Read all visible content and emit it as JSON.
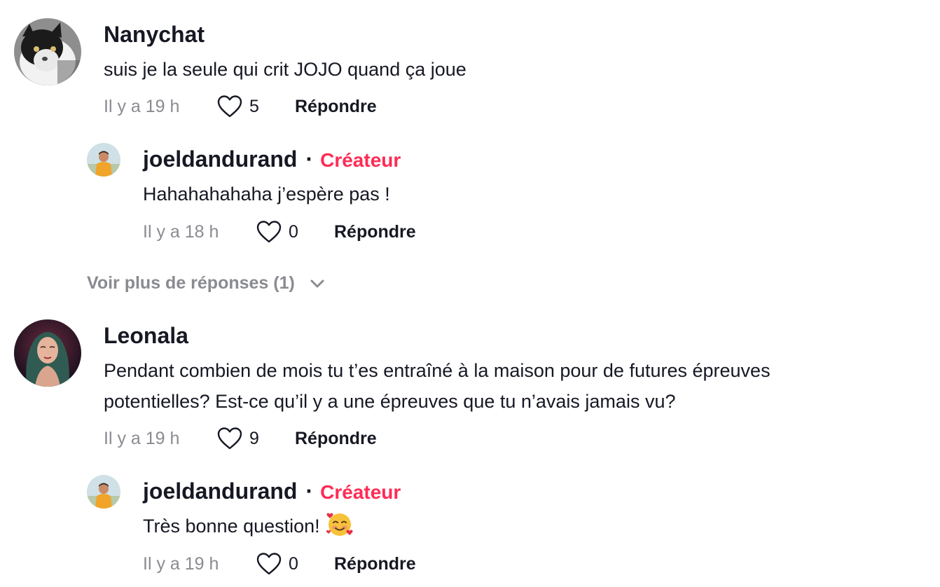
{
  "colors": {
    "text": "#161823",
    "muted": "#8a8b91",
    "creator": "#fe2c55"
  },
  "comments": [
    {
      "username": "Nanychat",
      "text": "suis je la seule qui crit JOJO quand ça joue",
      "time": "Il y a 19 h",
      "likes": "5",
      "reply_label": "Répondre",
      "avatar_icon": "cat-avatar",
      "reply": {
        "username": "joeldandurand",
        "separator": "·",
        "badge": "Créateur",
        "text": "Hahahahahaha j’espère pas !",
        "time": "Il y a 18 h",
        "likes": "0",
        "reply_label": "Répondre",
        "avatar_icon": "creator-avatar"
      },
      "more_replies": "Voir plus de réponses (1)"
    },
    {
      "username": "Leonala",
      "text_line1": "Pendant combien de mois tu t’es entraîné à la maison pour de futures épreuves",
      "text_line2": "potentielles? Est-ce qu’il y a une épreuves que tu n’avais jamais vu?",
      "time": "Il y a 19 h",
      "likes": "9",
      "reply_label": "Répondre",
      "avatar_icon": "woman-avatar",
      "reply": {
        "username": "joeldandurand",
        "separator": "·",
        "badge": "Créateur",
        "text": "Très bonne question!",
        "emoji_icon": "smiling-face-with-hearts-emoji",
        "time": "Il y a 19 h",
        "likes": "0",
        "reply_label": "Répondre",
        "avatar_icon": "creator-avatar"
      }
    }
  ]
}
